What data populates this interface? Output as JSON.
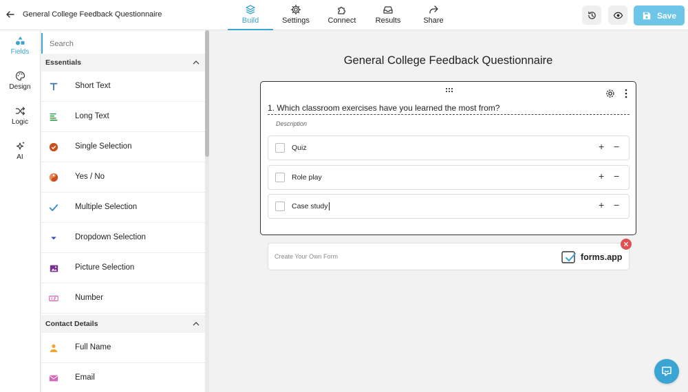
{
  "header": {
    "doc_title": "General College Feedback Questionnaire",
    "tabs": [
      {
        "label": "Build",
        "icon": "layers-icon",
        "active": true
      },
      {
        "label": "Settings",
        "icon": "gear-icon"
      },
      {
        "label": "Connect",
        "icon": "puzzle-icon"
      },
      {
        "label": "Results",
        "icon": "inbox-icon"
      },
      {
        "label": "Share",
        "icon": "share-arrow-icon"
      }
    ],
    "save_label": "Save",
    "accent": "#3aa4d3",
    "save_color": "#6dc6e7"
  },
  "rail": {
    "items": [
      {
        "label": "Fields",
        "icon": "shapes-icon",
        "active": true
      },
      {
        "label": "Design",
        "icon": "palette-icon"
      },
      {
        "label": "Logic",
        "icon": "shuffle-icon"
      },
      {
        "label": "AI",
        "icon": "sparkle-icon"
      }
    ]
  },
  "panel": {
    "search_placeholder": "Search",
    "sections": [
      {
        "title": "Essentials",
        "items": [
          {
            "label": "Short Text",
            "icon": "text-t-icon",
            "color": "#3a72b8"
          },
          {
            "label": "Long Text",
            "icon": "long-text-icon",
            "color": "#2f9e44"
          },
          {
            "label": "Single Selection",
            "icon": "check-circle-icon",
            "color": "#c8501f"
          },
          {
            "label": "Yes / No",
            "icon": "yes-no-icon",
            "color": "#c8501f"
          },
          {
            "label": "Multiple Selection",
            "icon": "checkmark-icon",
            "color": "#3a8fd6"
          },
          {
            "label": "Dropdown Selection",
            "icon": "dropdown-caret-icon",
            "color": "#2b47b8"
          },
          {
            "label": "Picture Selection",
            "icon": "picture-icon",
            "color": "#7a2f8f"
          },
          {
            "label": "Number",
            "icon": "number-icon",
            "color": "#d94aa8"
          }
        ]
      },
      {
        "title": "Contact Details",
        "items": [
          {
            "label": "Full Name",
            "icon": "person-icon",
            "color": "#f0a630"
          },
          {
            "label": "Email",
            "icon": "envelope-icon",
            "color": "#d06bb8"
          }
        ]
      }
    ]
  },
  "form": {
    "title": "General College Feedback Questionnaire",
    "question": {
      "text": "1. Which classroom exercises have you learned the most from?",
      "description": "Description",
      "options": [
        "Quiz",
        "Role play",
        "Case study"
      ]
    },
    "branding": {
      "text": "Create Your Own Form",
      "logo_text": "forms.app"
    }
  }
}
